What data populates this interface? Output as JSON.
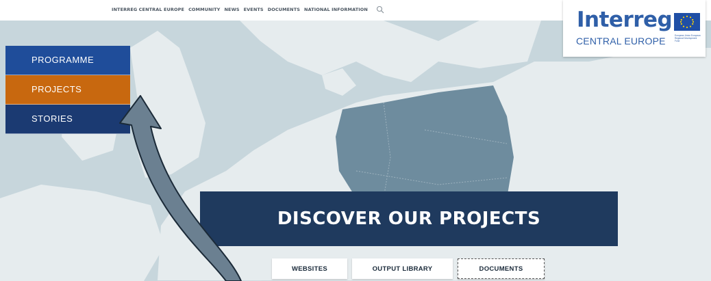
{
  "top_nav": {
    "items": [
      "INTERREG CENTRAL EUROPE",
      "COMMUNITY",
      "NEWS",
      "EVENTS",
      "DOCUMENTS",
      "NATIONAL INFORMATION"
    ],
    "search_icon": "search-icon"
  },
  "logo": {
    "wordmark": "Interreg",
    "subtitle": "CENTRAL EUROPE",
    "eu_text": "European Union European Regional Development Fund"
  },
  "side_menu": {
    "items": [
      "PROGRAMME",
      "PROJECTS",
      "STORIES"
    ],
    "active": "PROJECTS"
  },
  "hero": {
    "title": "DISCOVER OUR PROJECTS"
  },
  "buttons": {
    "websites": "WEBSITES",
    "output_library": "OUTPUT LIBRARY",
    "documents": "DOCUMENTS"
  },
  "colors": {
    "sea": "#c7d6dc",
    "land": "#e6ecee",
    "central_europe": "#6e8c9e",
    "programme": "#1f4d9a",
    "projects": "#c8680f",
    "stories": "#1b3a72",
    "hero_bg": "#1f3a5e",
    "logo_blue": "#2f5fa8"
  }
}
